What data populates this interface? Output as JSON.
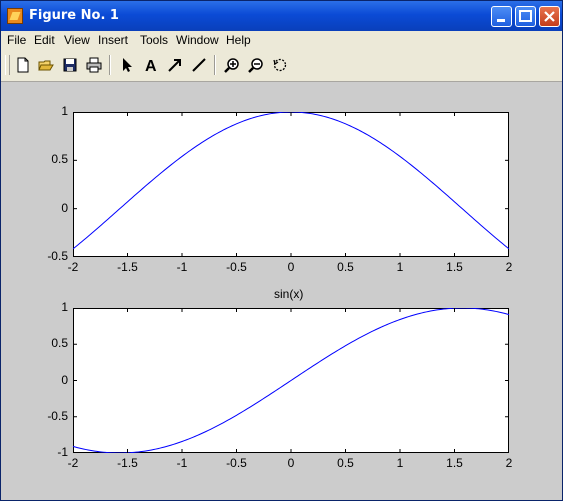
{
  "window": {
    "title": "Figure No. 1"
  },
  "menu": [
    "File",
    "Edit",
    "View",
    "Insert",
    "Tools",
    "Window",
    "Help"
  ],
  "toolbar": {
    "tools": [
      "new-file-icon",
      "open-folder-icon",
      "save-icon",
      "print-icon",
      "select-arrow-icon",
      "insert-text-icon",
      "insert-arrow-icon",
      "insert-line-icon",
      "zoom-in-icon",
      "zoom-out-icon",
      "rotate-icon"
    ]
  },
  "colors": {
    "line": "#0000ff",
    "frame_bg": "#cccccc",
    "axes_bg": "#ffffff"
  },
  "chart_data": [
    {
      "type": "line",
      "title": "",
      "function": "cos(x)",
      "xlim": [
        -2,
        2
      ],
      "ylim": [
        -0.5,
        1
      ],
      "xticks": [
        "-2",
        "-1.5",
        "-1",
        "-0.5",
        "0",
        "0.5",
        "1",
        "1.5",
        "2"
      ],
      "yticks": [
        "1",
        "0.5",
        "0",
        "-0.5"
      ],
      "x": [
        -2,
        -1.5,
        -1,
        -0.5,
        0,
        0.5,
        1,
        1.5,
        2
      ],
      "y": [
        -0.416,
        0.071,
        0.54,
        0.878,
        1.0,
        0.878,
        0.54,
        0.071,
        -0.416
      ]
    },
    {
      "type": "line",
      "title": "sin(x)",
      "function": "sin(x)",
      "xlim": [
        -2,
        2
      ],
      "ylim": [
        -1,
        1
      ],
      "xticks": [
        "-2",
        "-1.5",
        "-1",
        "-0.5",
        "0",
        "0.5",
        "1",
        "1.5",
        "2"
      ],
      "yticks": [
        "1",
        "0.5",
        "0",
        "-0.5",
        "-1"
      ],
      "x": [
        -2,
        -1.5,
        -1,
        -0.5,
        0,
        0.5,
        1,
        1.5,
        2
      ],
      "y": [
        -0.909,
        -0.997,
        -0.841,
        -0.479,
        0.0,
        0.479,
        0.841,
        0.997,
        0.909
      ]
    }
  ]
}
